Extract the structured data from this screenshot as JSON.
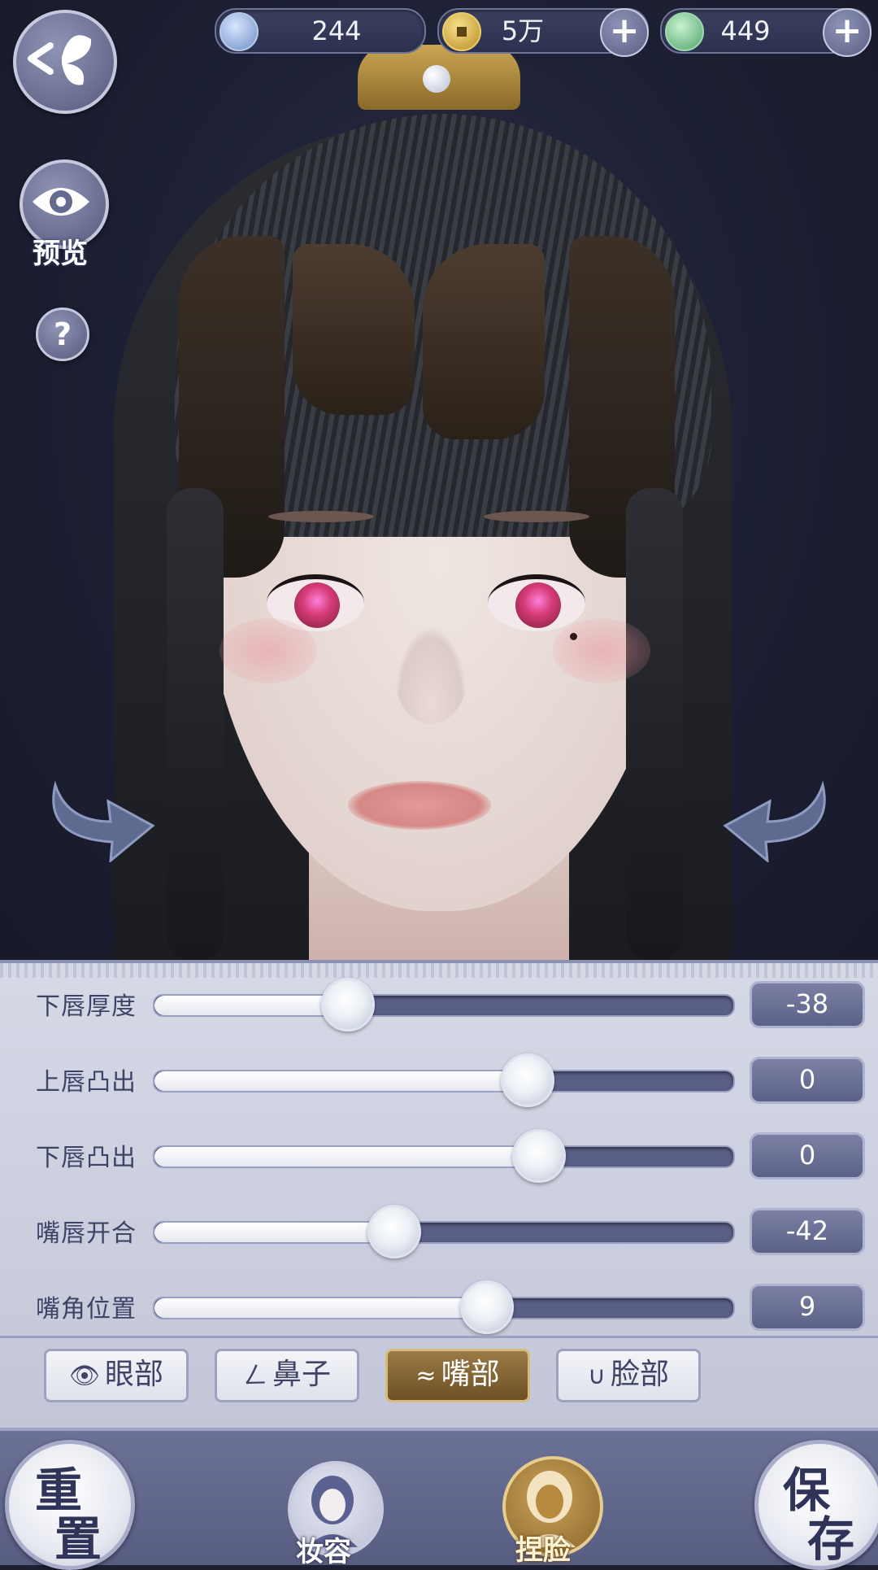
{
  "currency": [
    {
      "icon": "jade-feather-icon",
      "value": "244",
      "has_plus": false
    },
    {
      "icon": "copper-coin-icon",
      "value": "5万",
      "has_plus": true
    },
    {
      "icon": "green-spirit-icon",
      "value": "449",
      "has_plus": true
    }
  ],
  "sidebar": {
    "preview_label": "预览",
    "help_label": "?"
  },
  "sliders": [
    {
      "label": "下唇厚度",
      "value": "-38",
      "fraction": 0.33
    },
    {
      "label": "上唇凸出",
      "value": "0",
      "fraction": 0.64
    },
    {
      "label": "下唇凸出",
      "value": "0",
      "fraction": 0.66
    },
    {
      "label": "嘴唇开合",
      "value": "-42",
      "fraction": 0.41
    },
    {
      "label": "嘴角位置",
      "value": "9",
      "fraction": 0.57
    }
  ],
  "tabs": [
    {
      "label": "眼部",
      "icon": "eye-icon",
      "active": false
    },
    {
      "label": "鼻子",
      "icon": "nose-icon",
      "active": false
    },
    {
      "label": "嘴部",
      "icon": "mouth-icon",
      "active": true
    },
    {
      "label": "脸部",
      "icon": "face-icon",
      "active": false
    }
  ],
  "bottom_bar": {
    "reset_top": "重",
    "reset_bottom": "置",
    "makeup_label": "妆容",
    "face_shape_label": "捏脸",
    "save_top": "保",
    "save_bottom": "存"
  },
  "colors": {
    "accent_gold": "#9a7a45",
    "panel_bg": "#d6d9e6",
    "slider_track": "#5a5f85"
  }
}
